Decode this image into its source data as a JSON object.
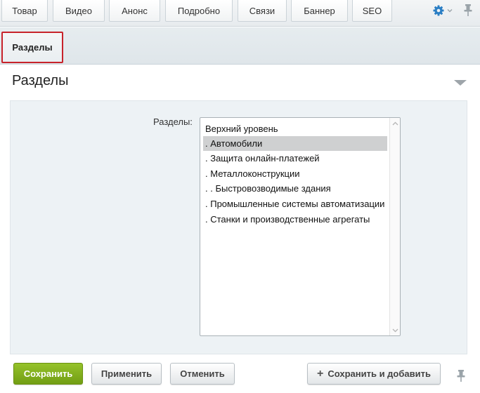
{
  "top_tabs": [
    {
      "label": "Товар"
    },
    {
      "label": "Видео"
    },
    {
      "label": "Анонс"
    },
    {
      "label": "Подробно"
    },
    {
      "label": "Связи"
    },
    {
      "label": "Баннер"
    },
    {
      "label": "SEO"
    }
  ],
  "header_icons": {
    "settings": "gear-icon",
    "settings_menu": "chevron-down-icon",
    "pin": "pin-icon",
    "accent_color": "#2a7ec4"
  },
  "sub_tabs": [
    {
      "label": "Разделы",
      "highlight_color": "#c7222a"
    }
  ],
  "section": {
    "title": "Разделы",
    "collapse_icon": "triangle-down-icon"
  },
  "sections_field": {
    "label": "Разделы:",
    "options": [
      {
        "label": "Верхний уровень",
        "selected": false
      },
      {
        "label": ". Автомобили",
        "selected": true
      },
      {
        "label": ". Защита онлайн-платежей",
        "selected": false
      },
      {
        "label": ". Металлоконструкции",
        "selected": false
      },
      {
        "label": ". . Быстровозводимые здания",
        "selected": false
      },
      {
        "label": ". Промышленные системы автоматизации",
        "selected": false
      },
      {
        "label": ". Станки и производственные агрегаты",
        "selected": false
      }
    ]
  },
  "buttons": {
    "save": "Сохранить",
    "apply": "Применить",
    "cancel": "Отменить",
    "save_and_add": "Сохранить и добавить",
    "save_color": "#86b31f"
  }
}
